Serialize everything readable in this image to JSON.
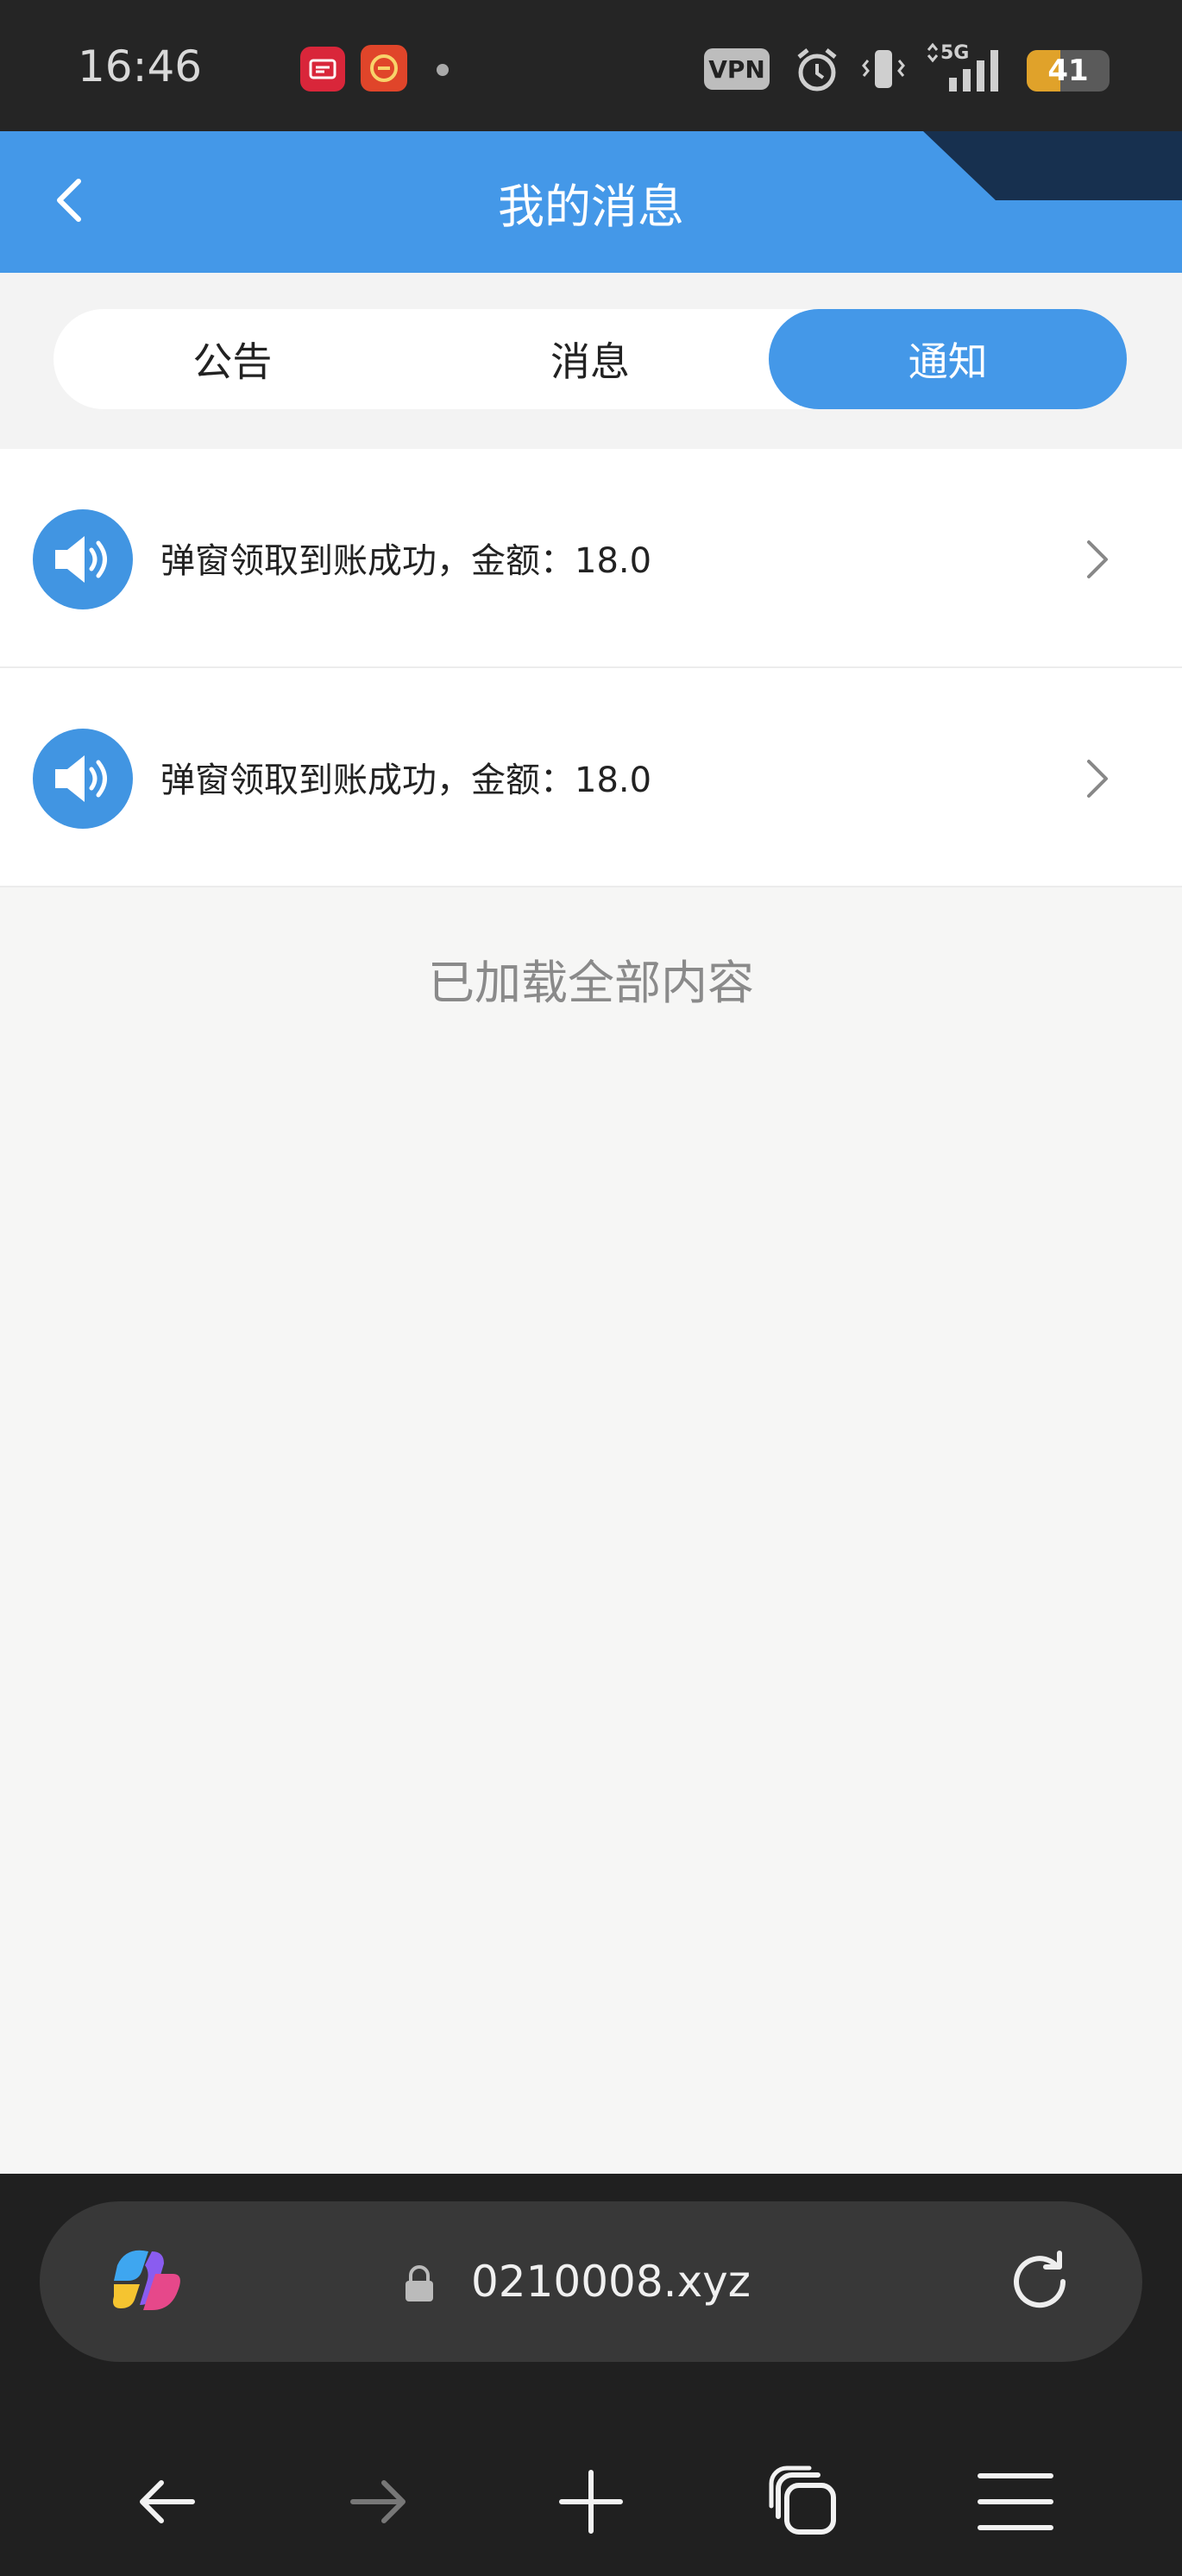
{
  "status_bar": {
    "time": "16:46",
    "vpn": "VPN",
    "network": "5G",
    "battery_level": "41",
    "battery_percent": 41,
    "icons": [
      "notification-app-icon",
      "taobao-app-icon",
      "alarm-icon",
      "vibrate-icon",
      "signal-icon",
      "battery-icon"
    ]
  },
  "header": {
    "title": "我的消息",
    "accent_color": "#4498e8"
  },
  "tabs": [
    {
      "label": "公告",
      "active": false
    },
    {
      "label": "消息",
      "active": false
    },
    {
      "label": "通知",
      "active": true
    }
  ],
  "notifications": [
    {
      "text": "弹窗领取到账成功，金额：18.0",
      "icon": "speaker-icon"
    },
    {
      "text": "弹窗领取到账成功，金额：18.0",
      "icon": "speaker-icon"
    }
  ],
  "list_end_text": "已加载全部内容",
  "browser": {
    "url": "0210008.xyz",
    "buttons": [
      "back",
      "forward",
      "new-tab",
      "tabs",
      "menu"
    ]
  }
}
